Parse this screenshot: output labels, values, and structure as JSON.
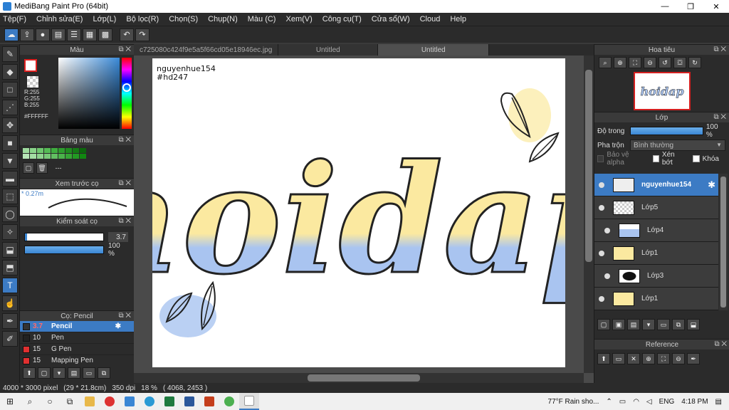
{
  "window": {
    "title": "MediBang Paint Pro (64bit)",
    "minimize": "—",
    "maximize": "❐",
    "close": "✕"
  },
  "menu": [
    "Tệp(F)",
    "Chỉnh sửa(E)",
    "Lớp(L)",
    "Bộ lọc(R)",
    "Chọn(S)",
    "Chụp(N)",
    "Màu (C)",
    "Xem(V)",
    "Công cụ(T)",
    "Cửa sổ(W)",
    "Cloud",
    "Help"
  ],
  "panels": {
    "color": "Màu",
    "palette": "Bảng màu",
    "brush_preview": "Xem trước cọ",
    "brush_control": "Kiểm soát cọ",
    "brush_list": "Cọ: Pencil",
    "navigator": "Hoa tiêu",
    "layer": "Lớp",
    "reference": "Reference"
  },
  "color": {
    "r": "R:255",
    "g": "G:255",
    "b": "B:255",
    "hex": "#FFFFFF"
  },
  "palette": {
    "dash": "---",
    "colors": [
      "#9fdc9f",
      "#8ad48a",
      "#6fc86f",
      "#55bb55",
      "#3fae3f",
      "#2e9e2e",
      "#1f8c1f",
      "#147a14",
      "#0c660c",
      "#b8e6b8",
      "#a4dea4",
      "#8fd48f",
      "#79ca79",
      "#62bf62",
      "#4bb34b",
      "#35a635",
      "#229922",
      "#118811"
    ]
  },
  "brush_preview": {
    "size": "* 0.27m"
  },
  "brush_control": {
    "size": "3.7",
    "opacity": "100 %",
    "size_fill": 0.03,
    "opacity_fill": 1.0
  },
  "brushes": [
    {
      "num": "3.7",
      "name": "Pencil",
      "color": "#333333",
      "selected": true
    },
    {
      "num": "10",
      "name": "Pen",
      "color": "#222222",
      "selected": false
    },
    {
      "num": "15",
      "name": "G Pen",
      "color": "#e03030",
      "selected": false
    },
    {
      "num": "15",
      "name": "Mapping Pen",
      "color": "#e03030",
      "selected": false
    }
  ],
  "document": {
    "tabs": [
      "c725080c424f9e5a5f66cd05e18946ec.jpg",
      "Untitled",
      "Untitled"
    ],
    "active_tab": 2,
    "watermark_line1": "nguyenhue154",
    "watermark_line2": "#hd247",
    "lettering": "hoidap"
  },
  "navigator": {
    "thumb_text": "hoidap"
  },
  "layer_props": {
    "opacity_label": "Độ trong",
    "opacity_value": "100 %",
    "blend_label": "Pha trộn",
    "blend_value": "Bình thường",
    "protect_alpha": "Bảo vệ alpha",
    "clipping": "Xén bớt",
    "lock": "Khóa"
  },
  "layers": [
    {
      "name": "nguyenhue154",
      "selected": true,
      "indent": false
    },
    {
      "name": "Lớp5",
      "selected": false,
      "indent": false
    },
    {
      "name": "Lớp4",
      "selected": false,
      "indent": true
    },
    {
      "name": "Lớp1",
      "selected": false,
      "indent": false
    },
    {
      "name": "Lớp3",
      "selected": false,
      "indent": true
    },
    {
      "name": "Lớp1",
      "selected": false,
      "indent": false
    }
  ],
  "status": {
    "size": "4000 * 3000 pixel",
    "dims": "(29 * 21.8cm)",
    "dpi": "350 dpi",
    "zoom": "18 %",
    "coords": "( 4068, 2453 )"
  },
  "taskbar": {
    "weather": "77°F  Rain sho...",
    "lang": "ENG",
    "time": "4:18 PM"
  },
  "colors": {
    "accent": "#3c7bc4",
    "yellow": "#fbe9a0",
    "blue": "#a9c4f0"
  }
}
